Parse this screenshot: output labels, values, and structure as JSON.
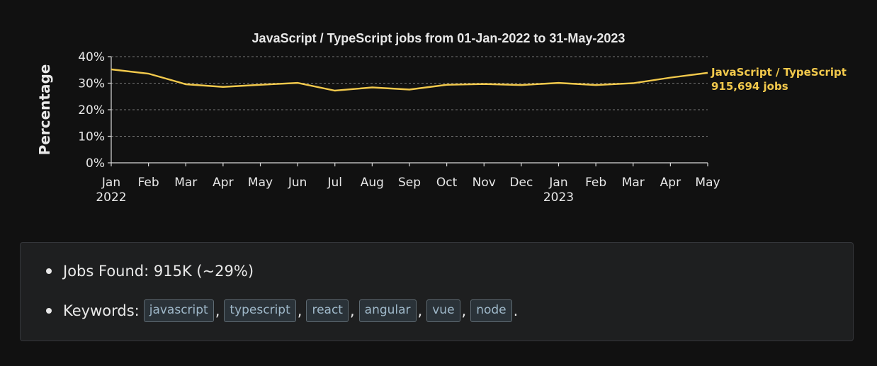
{
  "chart_data": {
    "type": "line",
    "title": "JavaScript / TypeScript jobs from 01-Jan-2022 to 31-May-2023",
    "xlabel": "",
    "ylabel": "Percentage",
    "ylim": [
      0,
      40
    ],
    "y_ticks": [
      "0%",
      "10%",
      "20%",
      "30%",
      "40%"
    ],
    "grid": true,
    "categories": [
      "Jan 2022",
      "Feb",
      "Mar",
      "Apr",
      "May",
      "Jun",
      "Jul",
      "Aug",
      "Sep",
      "Oct",
      "Nov",
      "Dec",
      "Jan 2023",
      "Feb",
      "Mar",
      "Apr",
      "May"
    ],
    "x_tick_labels": [
      {
        "month": "Jan",
        "year": "2022"
      },
      {
        "month": "Feb",
        "year": ""
      },
      {
        "month": "Mar",
        "year": ""
      },
      {
        "month": "Apr",
        "year": ""
      },
      {
        "month": "May",
        "year": ""
      },
      {
        "month": "Jun",
        "year": ""
      },
      {
        "month": "Jul",
        "year": ""
      },
      {
        "month": "Aug",
        "year": ""
      },
      {
        "month": "Sep",
        "year": ""
      },
      {
        "month": "Oct",
        "year": ""
      },
      {
        "month": "Nov",
        "year": ""
      },
      {
        "month": "Dec",
        "year": ""
      },
      {
        "month": "Jan",
        "year": "2023"
      },
      {
        "month": "Feb",
        "year": ""
      },
      {
        "month": "Mar",
        "year": ""
      },
      {
        "month": "Apr",
        "year": ""
      },
      {
        "month": "May",
        "year": ""
      }
    ],
    "series": [
      {
        "name": "JavaScript / TypeScript",
        "values": [
          35.2,
          33.6,
          29.6,
          28.6,
          29.4,
          30.1,
          27.2,
          28.4,
          27.6,
          29.4,
          29.7,
          29.3,
          30.1,
          29.3,
          30.0,
          32.1,
          33.9
        ],
        "color": "#f2c94c"
      }
    ],
    "end_label": {
      "line1": "JavaScript / TypeScript",
      "line2": "915,694 jobs"
    }
  },
  "info": {
    "jobs_found": "Jobs Found: 915K (~29%)",
    "keywords_label": "Keywords:",
    "keywords": [
      "javascript",
      "typescript",
      "react",
      "angular",
      "vue",
      "node"
    ],
    "separator": ",",
    "terminator": "."
  }
}
